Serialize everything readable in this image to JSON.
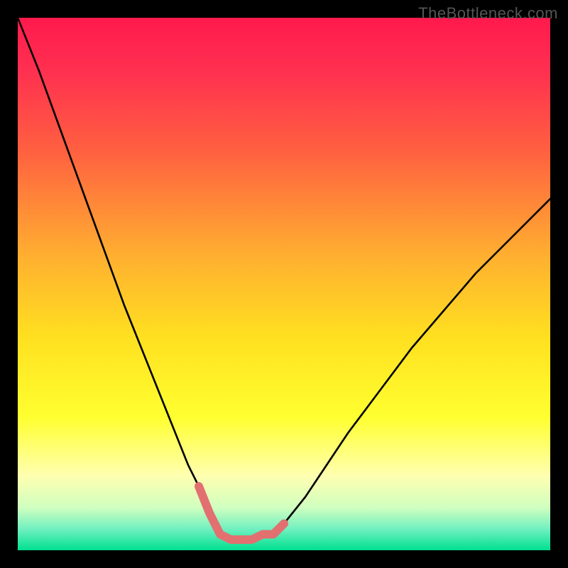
{
  "watermark": "TheBottleneck.com",
  "chart_data": {
    "type": "line",
    "title": "",
    "xlabel": "",
    "ylabel": "",
    "xlim": [
      0,
      100
    ],
    "ylim": [
      0,
      100
    ],
    "gradient_stops": [
      {
        "pos": 0.0,
        "color": "#ff1a4d"
      },
      {
        "pos": 0.1,
        "color": "#ff3050"
      },
      {
        "pos": 0.25,
        "color": "#ff6040"
      },
      {
        "pos": 0.45,
        "color": "#ffb030"
      },
      {
        "pos": 0.6,
        "color": "#ffe020"
      },
      {
        "pos": 0.75,
        "color": "#ffff30"
      },
      {
        "pos": 0.86,
        "color": "#ffffb0"
      },
      {
        "pos": 0.92,
        "color": "#d0ffc0"
      },
      {
        "pos": 0.96,
        "color": "#70f0c0"
      },
      {
        "pos": 1.0,
        "color": "#00e090"
      }
    ],
    "series": [
      {
        "name": "left-curve",
        "color": "#000000",
        "x": [
          0,
          4,
          8,
          12,
          16,
          20,
          24,
          28,
          30,
          32,
          34,
          36,
          37,
          38
        ],
        "y": [
          100,
          90,
          79,
          68,
          57,
          46,
          36,
          26,
          21,
          16,
          12,
          7,
          5,
          3
        ]
      },
      {
        "name": "right-curve",
        "color": "#000000",
        "x": [
          48,
          50,
          54,
          58,
          62,
          68,
          74,
          80,
          86,
          92,
          100
        ],
        "y": [
          3,
          5,
          10,
          16,
          22,
          30,
          38,
          45,
          52,
          58,
          66
        ]
      },
      {
        "name": "valley-highlight",
        "color": "#e27070",
        "x": [
          34,
          36,
          38,
          40,
          42,
          44,
          46,
          48,
          50
        ],
        "y": [
          12,
          7,
          3,
          2,
          2,
          2,
          3,
          3,
          5
        ]
      }
    ],
    "legend": [],
    "grid": false
  }
}
